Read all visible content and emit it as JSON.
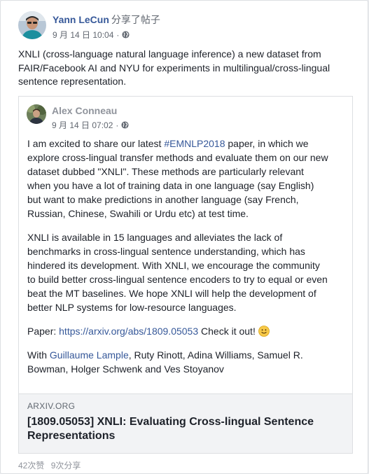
{
  "post": {
    "author": "Yann LeCun",
    "action": "分享了帖子",
    "timestamp": "9 月 14 日 10:04",
    "privacy_icon": "globe-icon",
    "text": "XNLI (cross-language natural language inference) a new dataset from FAIR/Facebook AI and NYU for experiments in multilingual/cross-lingual sentence representation."
  },
  "shared": {
    "author": "Alex Conneau",
    "timestamp": "9 月 14 日 07:02",
    "privacy_icon": "globe-icon",
    "p1_before": "I am excited to share our latest ",
    "p1_hashtag": "#EMNLP2018",
    "p1_after": " paper, in which we explore cross-lingual transfer methods and evaluate them on our new dataset dubbed \"XNLI\". These methods are particularly relevant when you have a lot of training data in one language (say English) but want to make predictions in another language (say French, Russian, Chinese, Swahili or Urdu etc) at test time.",
    "p2": "XNLI is available in 15 languages and alleviates the lack of benchmarks in cross-lingual sentence understanding, which has hindered its development. With XNLI, we encourage the community to build better cross-lingual sentence encoders to try to equal or even beat the MT baselines. We hope XNLI will help the development of better NLP systems for low-resource languages.",
    "p3_label": "Paper: ",
    "p3_link": "https://arxiv.org/abs/1809.05053",
    "p3_after": " Check it out!",
    "p3_emoji": "smile-emoji-icon",
    "p4_before": "With ",
    "p4_mention": "Guillaume Lample",
    "p4_after": ", Ruty Rinott, Adina Williams, Samuel R. Bowman, Holger Schwenk and Ves Stoyanov"
  },
  "link_card": {
    "domain": "ARXIV.ORG",
    "title": "[1809.05053] XNLI: Evaluating Cross-lingual Sentence Representations"
  },
  "footer": {
    "likes": "42次赞",
    "shares": "9次分享"
  },
  "colors": {
    "link": "#365899",
    "meta": "#616770",
    "card_bg": "#f2f3f5"
  }
}
